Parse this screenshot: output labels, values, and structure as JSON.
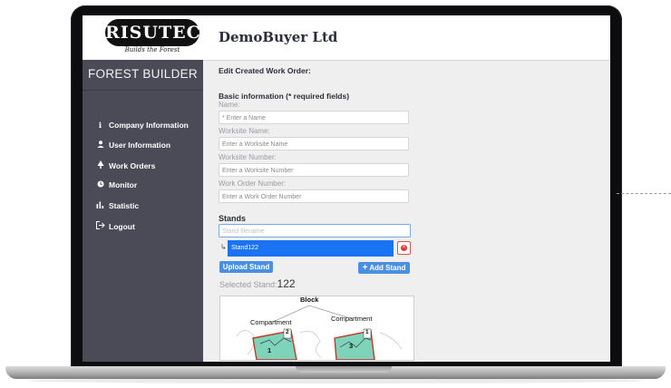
{
  "app": {
    "logo_text": "RISUTEC",
    "logo_tagline": "Builds the Forest",
    "company_name": "DemoBuyer Ltd"
  },
  "sidebar": {
    "title": "FOREST BUILDER",
    "items": [
      {
        "label": "Company Information",
        "icon": "info-icon",
        "glyph": "ℹ"
      },
      {
        "label": "User Information",
        "icon": "user-icon",
        "glyph": "👤"
      },
      {
        "label": "Work Orders",
        "icon": "tree-icon",
        "glyph": "♣"
      },
      {
        "label": "Monitor",
        "icon": "monitor-icon",
        "glyph": "●"
      },
      {
        "label": "Statistic",
        "icon": "bar-chart-icon",
        "glyph": "ıl"
      },
      {
        "label": "Logout",
        "icon": "logout-icon",
        "glyph": "⇥"
      }
    ]
  },
  "form": {
    "page_title": "Edit Created Work Order:",
    "basic_info_title": "Basic information (* required fields)",
    "name_label": "Name:",
    "name_placeholder": "* Enter a Name",
    "worksite_name_label": "Worksite Name:",
    "worksite_name_placeholder": "Enter a Worksite Name",
    "worksite_number_label": "Worksite Number:",
    "worksite_number_placeholder": "Enter a Worksite Number",
    "work_order_number_label": "Work Order Number:",
    "work_order_number_placeholder": "Enter a Work Order Number"
  },
  "stands": {
    "title": "Stands",
    "filename_placeholder": "Stand filename",
    "items": [
      {
        "label": "Stand122"
      }
    ],
    "upload_label": "Upload Stand",
    "add_label": "Add Stand",
    "selected_label": "Selected Stand:",
    "selected_value": "122"
  },
  "diagram": {
    "block_label": "Block",
    "compartment_label_1": "Compartment",
    "compartment_label_2": "Compartment",
    "compartment_number_1": "1",
    "compartment_number_2": "3",
    "sub_number_1": "2",
    "sub_number_2": "1"
  },
  "colors": {
    "sidebar_bg": "#4b4b57",
    "accent_blue": "#1a73f2",
    "button_blue": "#4a90e2",
    "remove_red": "#e53935",
    "compartment_fill": "#7fd3b8"
  }
}
